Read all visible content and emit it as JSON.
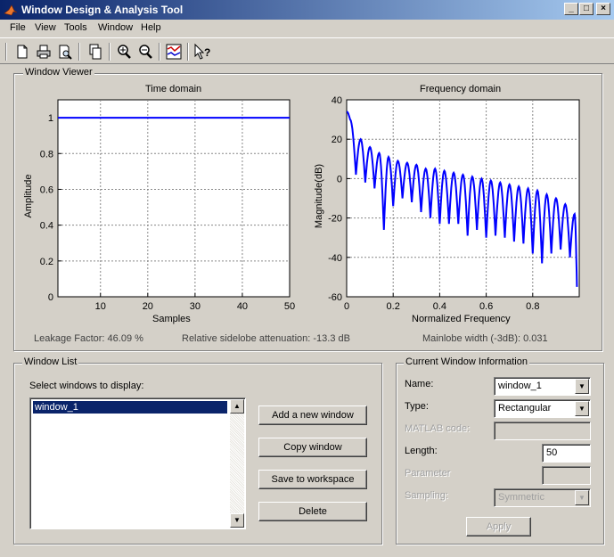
{
  "window": {
    "title": "Window Design & Analysis Tool"
  },
  "menu": [
    "File",
    "View",
    "Tools",
    "Window",
    "Help"
  ],
  "toolbar": {
    "icons": [
      "new-icon",
      "print-icon",
      "print-preview-icon",
      "copy-figure-icon",
      "zoom-in-icon",
      "zoom-out-icon",
      "full-view-icon",
      "whats-this-icon"
    ]
  },
  "viewer": {
    "title": "Window Viewer",
    "leakage": "Leakage Factor: 46.09 %",
    "sidelobe": "Relative sidelobe attenuation: -13.3 dB",
    "mainlobe": "Mainlobe width (-3dB): 0.031",
    "time": {
      "title": "Time domain",
      "xlabel": "Samples",
      "ylabel": "Amplitude"
    },
    "freq": {
      "title": "Frequency domain",
      "xlabel": "Normalized Frequency",
      "ylabel": "Magnitude(dB)"
    }
  },
  "chart_data": [
    {
      "type": "line",
      "title": "Time domain",
      "xlabel": "Samples",
      "ylabel": "Amplitude",
      "xlim": [
        1,
        50
      ],
      "ylim": [
        0,
        1.1
      ],
      "xticks": [
        10,
        20,
        30,
        40,
        50
      ],
      "yticks": [
        0,
        0.2,
        0.4,
        0.6,
        0.8,
        1
      ],
      "ytick_labels": [
        "0",
        "0.2",
        "0.4",
        "0.6",
        "0.8",
        "1"
      ],
      "grid": true,
      "series": [
        {
          "x": [
            1,
            50
          ],
          "y": [
            1,
            1
          ]
        }
      ]
    },
    {
      "type": "line",
      "title": "Frequency domain",
      "xlabel": "Normalized Frequency",
      "ylabel": "Magnitude(dB)",
      "xlim": [
        0,
        1
      ],
      "ylim": [
        -60,
        40
      ],
      "xticks": [
        0,
        0.2,
        0.4,
        0.6,
        0.8
      ],
      "xtick_labels": [
        "0",
        "0.2",
        "0.4",
        "0.6",
        "0.8"
      ],
      "yticks": [
        -60,
        -40,
        -20,
        0,
        20,
        40
      ],
      "grid": true,
      "window_length": 50,
      "peak_db": 34,
      "sidelobe_peaks": [
        [
          0.06,
          20
        ],
        [
          0.1,
          16
        ],
        [
          0.14,
          13
        ],
        [
          0.18,
          11
        ],
        [
          0.22,
          9
        ],
        [
          0.26,
          8
        ],
        [
          0.3,
          7
        ],
        [
          0.34,
          5
        ],
        [
          0.38,
          5
        ],
        [
          0.42,
          4
        ],
        [
          0.46,
          3
        ],
        [
          0.5,
          2
        ],
        [
          0.54,
          1
        ],
        [
          0.58,
          0
        ],
        [
          0.62,
          -1
        ],
        [
          0.66,
          -2
        ],
        [
          0.7,
          -3
        ],
        [
          0.74,
          -4
        ],
        [
          0.78,
          -5
        ],
        [
          0.82,
          -6
        ],
        [
          0.86,
          -8
        ],
        [
          0.9,
          -10
        ],
        [
          0.94,
          -13
        ],
        [
          0.98,
          -18
        ]
      ],
      "null_depths": [
        [
          0.04,
          2
        ],
        [
          0.08,
          -2
        ],
        [
          0.12,
          -5
        ],
        [
          0.16,
          -26
        ],
        [
          0.2,
          -14
        ],
        [
          0.24,
          -10
        ],
        [
          0.28,
          -12
        ],
        [
          0.32,
          -17
        ],
        [
          0.36,
          -20
        ],
        [
          0.4,
          -23
        ],
        [
          0.44,
          -23
        ],
        [
          0.48,
          -23
        ],
        [
          0.52,
          -29
        ],
        [
          0.56,
          -26
        ],
        [
          0.6,
          -30
        ],
        [
          0.64,
          -29
        ],
        [
          0.68,
          -30
        ],
        [
          0.72,
          -32
        ],
        [
          0.76,
          -33
        ],
        [
          0.8,
          -38
        ],
        [
          0.84,
          -43
        ],
        [
          0.88,
          -38
        ],
        [
          0.92,
          -36
        ],
        [
          0.96,
          -40
        ],
        [
          0.99,
          -55
        ]
      ]
    }
  ],
  "window_list": {
    "title": "Window List",
    "prompt": "Select windows to display:",
    "items": [
      "window_1"
    ],
    "buttons": {
      "add": "Add a new window",
      "copy": "Copy window",
      "save": "Save to workspace",
      "delete": "Delete"
    }
  },
  "info": {
    "title": "Current Window Information",
    "name_label": "Name:",
    "name_value": "window_1",
    "type_label": "Type:",
    "type_value": "Rectangular",
    "matlab_label": "MATLAB code:",
    "matlab_value": "",
    "length_label": "Length:",
    "length_value": "50",
    "parameter_label": "Parameter",
    "parameter_value": "",
    "sampling_label": "Sampling:",
    "sampling_value": "Symmetric",
    "apply": "Apply"
  }
}
